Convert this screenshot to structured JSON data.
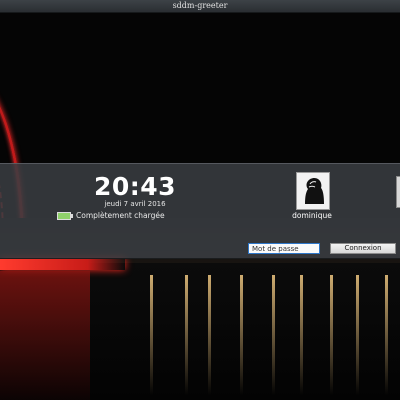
{
  "window": {
    "title": "sddm-greeter"
  },
  "clock": {
    "time": "20:43",
    "date": "jeudi 7 avril 2016"
  },
  "battery": {
    "status": "Complètement chargée",
    "level": 1.0,
    "icon": "battery-full-icon"
  },
  "user": {
    "name": "dominique",
    "avatar_icon": "user-silhouette-icon"
  },
  "login": {
    "password_placeholder": "Mot de passe",
    "connect_label": "Connexion"
  },
  "colors": {
    "panel": "#3a3e42",
    "accent": "#2e77c9",
    "wheel": "#c01a1a",
    "background": "#000000"
  }
}
